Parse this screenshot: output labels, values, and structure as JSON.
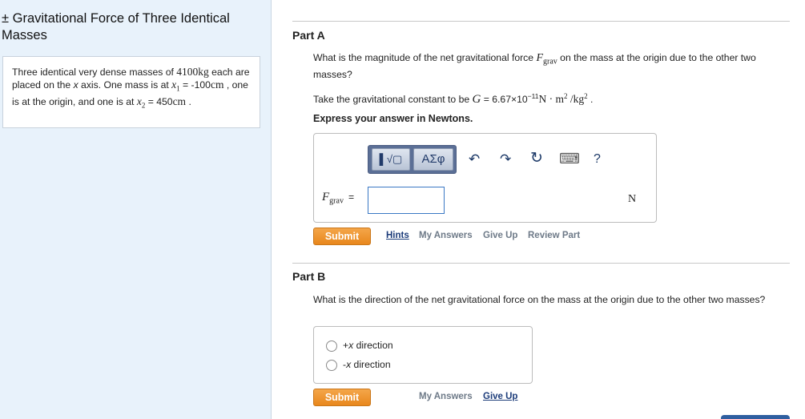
{
  "sidebar": {
    "title": "± Gravitational Force of Three Identical Masses",
    "problem": {
      "t1": "Three identical very dense masses of ",
      "mass_value": "4100",
      "mass_unit": "kg",
      "t2": " each are placed on the ",
      "x_axis": "x",
      "t3": " axis. One mass is at ",
      "x1_sym": "x",
      "x1_sub": "1",
      "t4": " = -",
      "x1_value": "100",
      "x1_unit": "cm",
      "t5": " , one is at the origin, and one is at ",
      "x2_sym": "x",
      "x2_sub": "2",
      "t6": " = ",
      "x2_value": "450",
      "x2_unit": "cm",
      "t7": " ."
    }
  },
  "partA": {
    "label": "Part A",
    "q_pre": "What is the magnitude of the net gravitational force ",
    "F": "F",
    "F_sub": "grav",
    "q_post": " on the mass at the origin due to the other two masses?",
    "g_pre": "Take the gravitational constant to be ",
    "G": "G",
    "g_eq": " = 6.67×10",
    "g_exp": "−11",
    "g_units": "N · m",
    "g_m_exp": "2",
    "g_slash": " /kg",
    "g_kg_exp": "2",
    "g_end": " .",
    "instruction": "Express your answer in Newtons.",
    "toolbar": {
      "sqrt_label": "▌√▢",
      "greek_label": "ΑΣφ",
      "undo": "↶",
      "redo": "↷",
      "reset": "↻",
      "keyboard": "⌨",
      "help": "?"
    },
    "answer_label_F": "F",
    "answer_label_sub": "grav",
    "answer_eq": "=",
    "answer_value": "",
    "unit": "N",
    "submit": "Submit",
    "hints": "Hints",
    "my_answers": "My Answers",
    "give_up": "Give Up",
    "review_part": "Review Part"
  },
  "partB": {
    "label": "Part B",
    "question": "What is the direction of the net gravitational force on the mass at the origin due to the other two masses?",
    "options": [
      {
        "sign": "+",
        "axis": "x",
        "rest": " direction"
      },
      {
        "sign": "-",
        "axis": "x",
        "rest": " direction"
      }
    ],
    "submit": "Submit",
    "my_answers": "My Answers",
    "give_up": "Give Up"
  },
  "colors": {
    "sidebar_bg": "#e8f2fb",
    "submit_orange": "#e8871c",
    "link_blue": "#1c3c7a",
    "toolbar_blue": "#5b6f96"
  }
}
